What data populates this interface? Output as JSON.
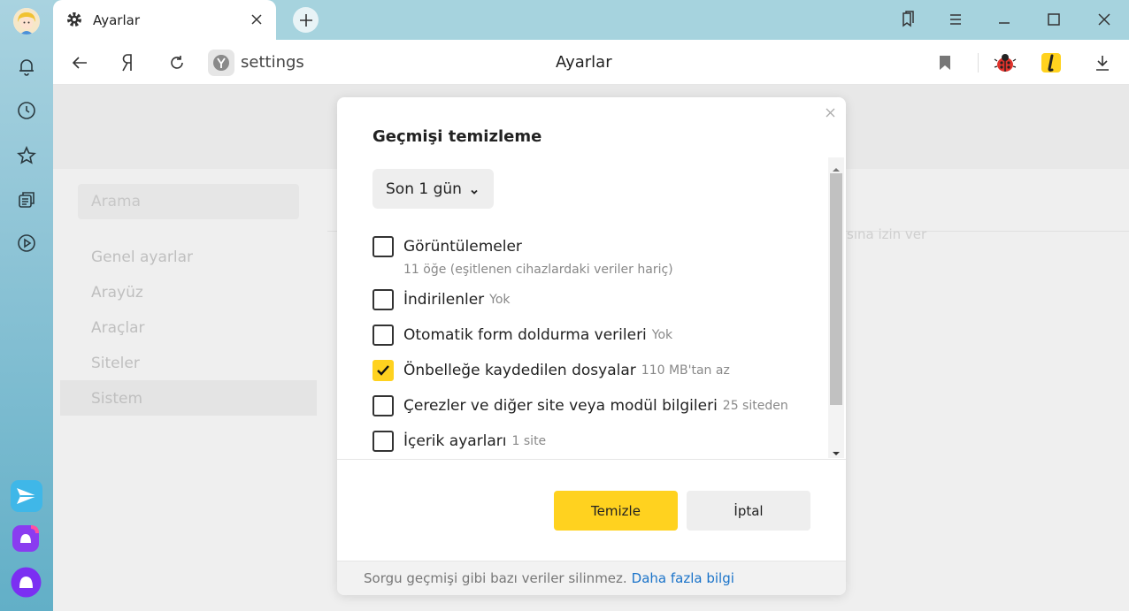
{
  "tab": {
    "title": "Ayarlar"
  },
  "address_bar": {
    "url": "settings",
    "page_title": "Ayarlar"
  },
  "sidebar": {
    "search_placeholder": "Arama",
    "items": [
      {
        "label": "Genel ayarlar"
      },
      {
        "label": "Arayüz"
      },
      {
        "label": "Araçlar"
      },
      {
        "label": "Siteler"
      },
      {
        "label": "Sistem",
        "active": true
      }
    ]
  },
  "background_hint": "sına izin ver",
  "dialog": {
    "title": "Geçmişi temizleme",
    "period": "Son 1 gün",
    "options": [
      {
        "label": "Görüntülemeler",
        "meta": "",
        "sub": "11 öğe (eşitlenen cihazlardaki veriler hariç)",
        "checked": false
      },
      {
        "label": "İndirilenler",
        "meta": "Yok",
        "checked": false
      },
      {
        "label": "Otomatik form doldurma verileri",
        "meta": "Yok",
        "checked": false
      },
      {
        "label": "Önbelleğe kaydedilen dosyalar",
        "meta": "110 MB'tan az",
        "checked": true
      },
      {
        "label": "Çerezler ve diğer site veya modül bilgileri",
        "meta": "25 siteden",
        "checked": false
      },
      {
        "label": "İçerik ayarları",
        "meta": "1 site",
        "checked": false
      }
    ],
    "primary_button": "Temizle",
    "secondary_button": "İptal",
    "footer_text": "Sorgu geçmişi gibi bazı veriler silinmez.",
    "footer_link": "Daha fazla bilgi"
  },
  "colors": {
    "accent": "#ffd21f",
    "link": "#1a73c9"
  }
}
